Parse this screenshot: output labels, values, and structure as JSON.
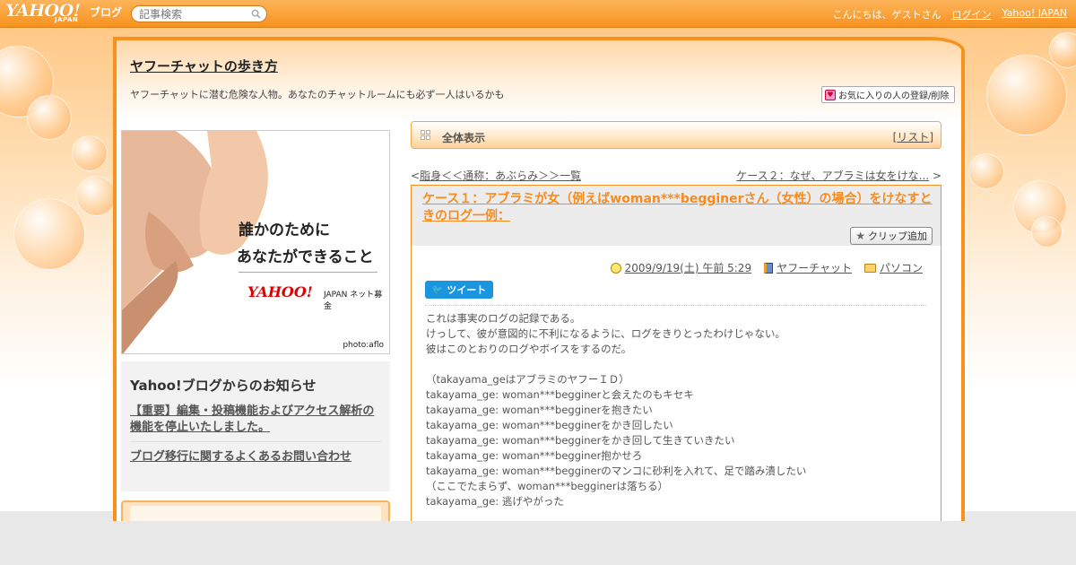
{
  "topbar": {
    "logo": "YAHOO!",
    "logo_sub": "JAPAN",
    "logo_blog": "ブログ",
    "search_placeholder": "記事検索",
    "greeting": "こんにちは、ゲストさん",
    "login": "ログイン",
    "yahoo_japan": "Yahoo! JAPAN"
  },
  "header": {
    "title": "ヤフーチャットの歩き方",
    "description": "ヤフーチャットに潜む危険な人物。あなたのチャットルームにも必ず一人はいるかも",
    "fav_button": "お気に入りの人の登録/削除"
  },
  "ad": {
    "line1": "誰かのために",
    "line2": "あなたができること",
    "logo": "YAHOO!",
    "logo_sub": "JAPAN ネット募金",
    "credit": "photo:aflo"
  },
  "notice": {
    "title": "Yahoo!ブログからのお知らせ",
    "links": [
      "【重要】編集・投稿機能およびアクセス解析の機能を停止いたしました。",
      "ブログ移行に関するよくあるお問い合わせ"
    ]
  },
  "bar": {
    "label": "全体表示",
    "list_open": "[",
    "list_link": "リスト",
    "list_close": "]"
  },
  "nav": {
    "prev_arrow": "<",
    "prev": "脂身＜＜通称：あぶらみ＞＞一覧",
    "next": "ケース２：なぜ、アブラミは女をけな...",
    "next_arrow": ">"
  },
  "article": {
    "title": "ケース１：アブラミが女（例えばwoman***begginerさん（女性）の場合）をけなすときのログ一例：",
    "clip": "クリップ追加",
    "date": "2009/9/19(土) 午前 5:29",
    "category1": "ヤフーチャット",
    "category2": "パソコン",
    "tweet": "ツイート",
    "body": "これは事実のログの記録である。\nけっして、彼が意図的に不利になるように、ログをきりとったわけじゃない。\n彼はこのとおりのログやボイスをするのだ。\n\n（takayama_geはアブラミのヤフーＩＤ）\ntakayama_ge: woman***begginerと会えたのもキセキ\ntakayama_ge: woman***begginerを抱きたい\ntakayama_ge: woman***begginerをかき回したい\ntakayama_ge: woman***begginerをかき回して生きていきたい\ntakayama_ge: woman***begginer抱かせろ\ntakayama_ge: woman***begginerのマンコに砂利を入れて、足で踏み潰したい\n（ここでたまらず、woman***begginerは落ちる）\ntakayama_ge: 逃げやがった"
  },
  "colors": {
    "accent": "#f7921e",
    "title_orange": "#f78b1e",
    "tweet_blue": "#1b95e0"
  },
  "icons": [
    "search-icon",
    "heart-icon",
    "grid-icon",
    "star-icon",
    "clock-icon",
    "book-icon",
    "folder-icon",
    "bird-icon"
  ]
}
